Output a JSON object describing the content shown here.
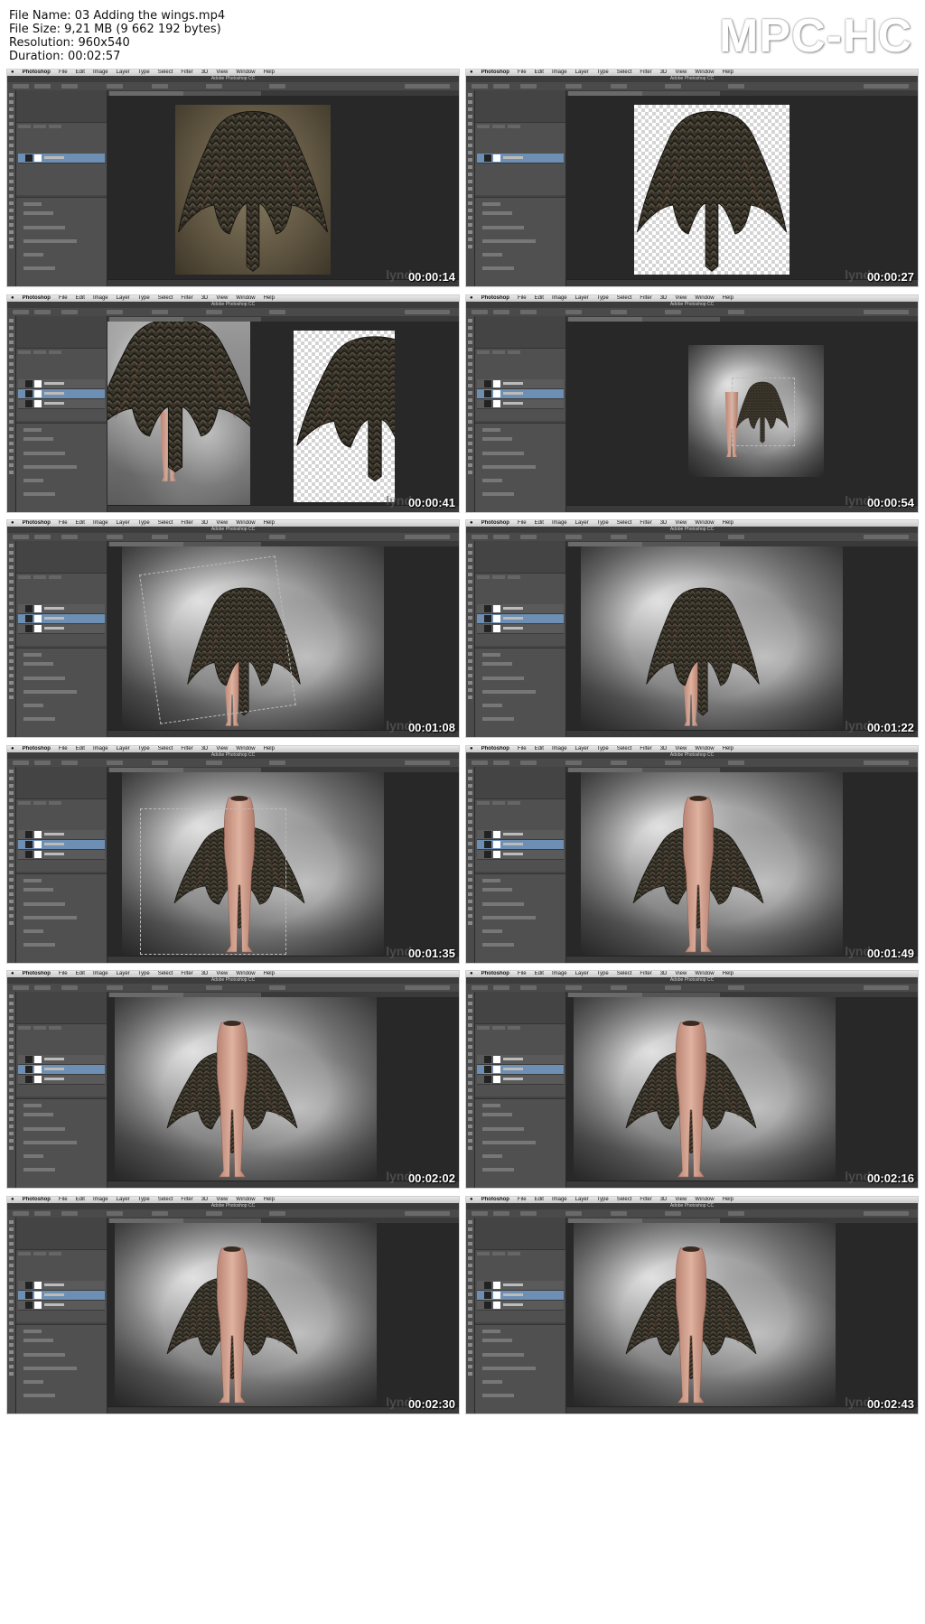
{
  "info": {
    "file_name": "File Name: 03 Adding the wings.mp4",
    "file_size": "File Size: 9,21 MB (9 662 192 bytes)",
    "resolution": "Resolution: 960x540",
    "duration": "Duration: 00:02:57"
  },
  "brand": "MPC-HC",
  "app": {
    "title": "Adobe Photoshop CC",
    "menu": [
      "Photoshop",
      "File",
      "Edit",
      "Image",
      "Layer",
      "Type",
      "Select",
      "Filter",
      "3D",
      "View",
      "Window",
      "Help"
    ]
  },
  "watermark": "lynd",
  "frames": [
    {
      "timestamp": "00:00:14",
      "scene": "photo"
    },
    {
      "timestamp": "00:00:27",
      "scene": "cutout"
    },
    {
      "timestamp": "00:00:41",
      "scene": "split"
    },
    {
      "timestamp": "00:00:54",
      "scene": "small"
    },
    {
      "timestamp": "00:01:08",
      "scene": "transform"
    },
    {
      "timestamp": "00:01:22",
      "scene": "wings"
    },
    {
      "timestamp": "00:01:35",
      "scene": "body-transform"
    },
    {
      "timestamp": "00:01:49",
      "scene": "body"
    },
    {
      "timestamp": "00:02:02",
      "scene": "body"
    },
    {
      "timestamp": "00:02:16",
      "scene": "body"
    },
    {
      "timestamp": "00:02:30",
      "scene": "body"
    },
    {
      "timestamp": "00:02:43",
      "scene": "body"
    }
  ],
  "colors": {
    "ui_dark": "#2b2b2b",
    "panel": "#505050",
    "layer_selected": "#6d8fb3",
    "feather_dark": "#2e2a22",
    "feather_light": "#6b6450",
    "skin": "#d7a592"
  }
}
